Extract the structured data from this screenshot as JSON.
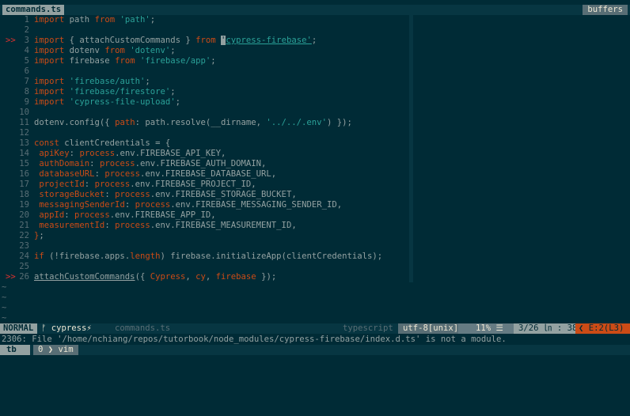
{
  "tabline": {
    "active_tab": "commands.ts",
    "buffers_label": "buffers"
  },
  "editor": {
    "sign_marker": ">>",
    "lines": [
      {
        "n": "1",
        "sign": false,
        "parts": [
          [
            "kw",
            "import"
          ],
          [
            "",
            "  path "
          ],
          [
            "kw",
            "from"
          ],
          [
            "",
            "  "
          ],
          [
            "str",
            "'path'"
          ],
          [
            "",
            ";"
          ]
        ]
      },
      {
        "n": "2",
        "sign": false,
        "parts": []
      },
      {
        "n": "3",
        "sign": true,
        "parts": [
          [
            "kw",
            "import"
          ],
          [
            "",
            "  { attachCustomCommands } "
          ],
          [
            "kw",
            "from"
          ],
          [
            "",
            "  "
          ],
          [
            "cur",
            "'"
          ],
          [
            "ulstr",
            "cypress-firebase'"
          ],
          [
            "",
            ";"
          ]
        ]
      },
      {
        "n": "4",
        "sign": false,
        "parts": [
          [
            "kw",
            "import"
          ],
          [
            "",
            "  dotenv "
          ],
          [
            "kw",
            "from"
          ],
          [
            "",
            "  "
          ],
          [
            "str",
            "'dotenv'"
          ],
          [
            "",
            ";"
          ]
        ]
      },
      {
        "n": "5",
        "sign": false,
        "parts": [
          [
            "kw",
            "import"
          ],
          [
            "",
            "  firebase "
          ],
          [
            "kw",
            "from"
          ],
          [
            "",
            "  "
          ],
          [
            "str",
            "'firebase/app'"
          ],
          [
            "",
            ";"
          ]
        ]
      },
      {
        "n": "6",
        "sign": false,
        "parts": []
      },
      {
        "n": "7",
        "sign": false,
        "parts": [
          [
            "kw",
            "import"
          ],
          [
            "",
            "  "
          ],
          [
            "str",
            "'firebase/auth'"
          ],
          [
            "",
            ";"
          ]
        ]
      },
      {
        "n": "8",
        "sign": false,
        "parts": [
          [
            "kw",
            "import"
          ],
          [
            "",
            "  "
          ],
          [
            "str",
            "'firebase/firestore'"
          ],
          [
            "",
            ";"
          ]
        ]
      },
      {
        "n": "9",
        "sign": false,
        "parts": [
          [
            "kw",
            "import"
          ],
          [
            "",
            "  "
          ],
          [
            "str",
            "'cypress-file-upload'"
          ],
          [
            "",
            ";"
          ]
        ]
      },
      {
        "n": "10",
        "sign": false,
        "parts": []
      },
      {
        "n": "11",
        "sign": false,
        "parts": [
          [
            "",
            "dotenv.config({ "
          ],
          [
            "kw",
            "path"
          ],
          [
            "",
            ": path.resolve(__dirname, "
          ],
          [
            "str",
            "'../../.env'"
          ],
          [
            "",
            ") });"
          ]
        ]
      },
      {
        "n": "12",
        "sign": false,
        "parts": []
      },
      {
        "n": "13",
        "sign": false,
        "parts": [
          [
            "kw",
            "const"
          ],
          [
            "",
            "  clientCredentials = {"
          ]
        ]
      },
      {
        "n": "14",
        "sign": false,
        "parts": [
          [
            "",
            "  "
          ],
          [
            "kw",
            "apiKey"
          ],
          [
            "",
            ": "
          ],
          [
            "kw",
            "process"
          ],
          [
            "",
            ".env.FIREBASE_API_KEY,"
          ]
        ]
      },
      {
        "n": "15",
        "sign": false,
        "parts": [
          [
            "",
            "  "
          ],
          [
            "kw",
            "authDomain"
          ],
          [
            "",
            ": "
          ],
          [
            "kw",
            "process"
          ],
          [
            "",
            ".env.FIREBASE_AUTH_DOMAIN,"
          ]
        ]
      },
      {
        "n": "16",
        "sign": false,
        "parts": [
          [
            "",
            "  "
          ],
          [
            "kw",
            "databaseURL"
          ],
          [
            "",
            ": "
          ],
          [
            "kw",
            "process"
          ],
          [
            "",
            ".env.FIREBASE_DATABASE_URL,"
          ]
        ]
      },
      {
        "n": "17",
        "sign": false,
        "parts": [
          [
            "",
            "  "
          ],
          [
            "kw",
            "projectId"
          ],
          [
            "",
            ": "
          ],
          [
            "kw",
            "process"
          ],
          [
            "",
            ".env.FIREBASE_PROJECT_ID,"
          ]
        ]
      },
      {
        "n": "18",
        "sign": false,
        "parts": [
          [
            "",
            "  "
          ],
          [
            "kw",
            "storageBucket"
          ],
          [
            "",
            ": "
          ],
          [
            "kw",
            "process"
          ],
          [
            "",
            ".env.FIREBASE_STORAGE_BUCKET,"
          ]
        ]
      },
      {
        "n": "19",
        "sign": false,
        "parts": [
          [
            "",
            "  "
          ],
          [
            "kw",
            "messagingSenderId"
          ],
          [
            "",
            ": "
          ],
          [
            "kw",
            "process"
          ],
          [
            "",
            ".env.FIREBASE_MESSAGING_SENDER_ID,"
          ]
        ]
      },
      {
        "n": "20",
        "sign": false,
        "parts": [
          [
            "",
            "  "
          ],
          [
            "kw",
            "appId"
          ],
          [
            "",
            ": "
          ],
          [
            "kw",
            "process"
          ],
          [
            "",
            ".env.FIREBASE_APP_ID,"
          ]
        ]
      },
      {
        "n": "21",
        "sign": false,
        "parts": [
          [
            "",
            "  "
          ],
          [
            "kw",
            "measurementId"
          ],
          [
            "",
            ": "
          ],
          [
            "kw",
            "process"
          ],
          [
            "",
            ".env.FIREBASE_MEASUREMENT_ID,"
          ]
        ]
      },
      {
        "n": "22",
        "sign": false,
        "parts": [
          [
            "kw",
            "}"
          ],
          [
            "",
            ";"
          ]
        ]
      },
      {
        "n": "23",
        "sign": false,
        "parts": []
      },
      {
        "n": "24",
        "sign": false,
        "parts": [
          [
            "kw",
            "if"
          ],
          [
            "",
            "  (!firebase.apps."
          ],
          [
            "kw",
            "length"
          ],
          [
            "",
            ") firebase.initializeApp(clientCredentials);"
          ]
        ]
      },
      {
        "n": "25",
        "sign": false,
        "parts": []
      },
      {
        "n": "26",
        "sign": true,
        "parts": [
          [
            "ul",
            "attachCustomCommands"
          ],
          [
            "",
            "({ "
          ],
          [
            "kw",
            "Cypress"
          ],
          [
            "",
            ", "
          ],
          [
            "kw",
            "cy"
          ],
          [
            "",
            ", "
          ],
          [
            "kw",
            "firebase"
          ],
          [
            "",
            "  });"
          ]
        ]
      }
    ],
    "tilde_count": 4,
    "tilde": "~"
  },
  "statusline": {
    "mode": "NORMAL",
    "branch": "ᚠ cypress⚡",
    "filename": "commands.ts",
    "filetype": "typescript",
    "encoding": "utf-8[unix]",
    "percent": "11% ☰",
    "position": "3/26 ㏑ : 38",
    "errors": "❮ E:2(L3)"
  },
  "cmdline": {
    "message": "2306: File '/home/nchiang/repos/tutorbook/node_modules/cypress-firebase/index.d.ts' is not a module."
  },
  "tmux": {
    "session": "tb",
    "window": "0 ❯ vim"
  },
  "colors": {
    "background": "#002b36",
    "keyword": "#cb4b16",
    "string": "#2aa198",
    "sign": "#dc322f"
  }
}
